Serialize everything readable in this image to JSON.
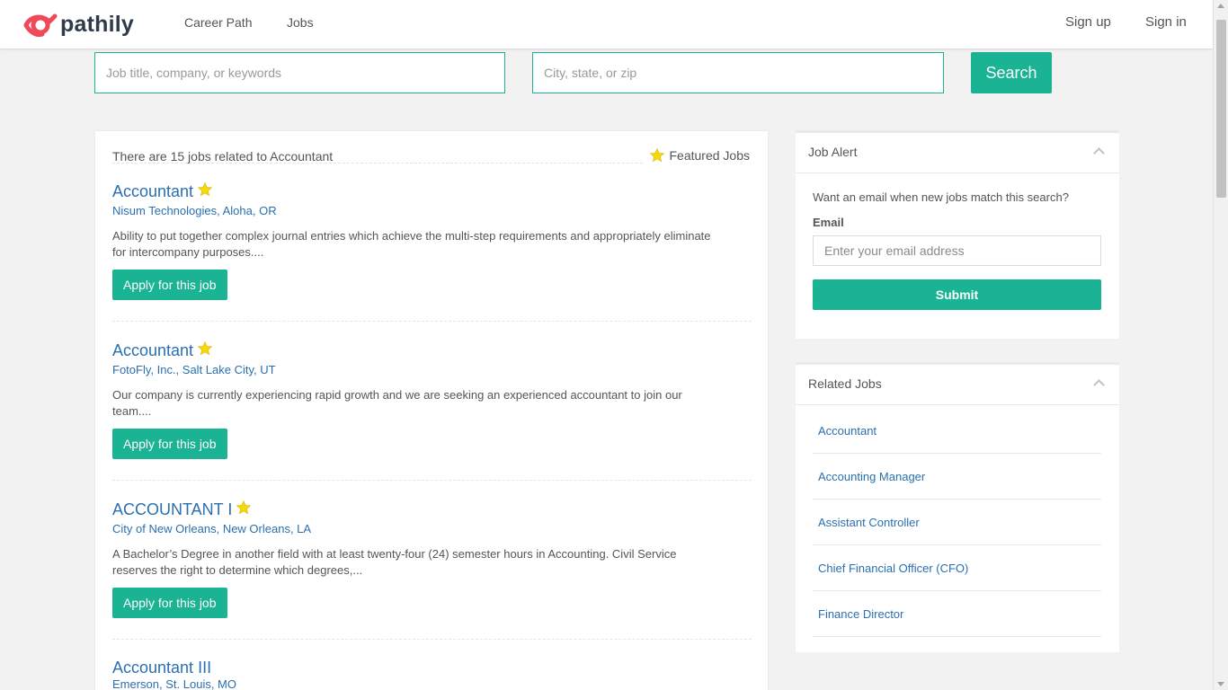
{
  "header": {
    "brand": "pathily",
    "nav": [
      "Career Path",
      "Jobs"
    ],
    "sign_up": "Sign up",
    "sign_in": "Sign in"
  },
  "search": {
    "keywords_placeholder": "Job title, company, or keywords",
    "location_placeholder": "City, state, or zip",
    "button": "Search"
  },
  "results": {
    "summary": "There are 15 jobs related to Accountant",
    "featured_label": "Featured Jobs",
    "jobs": [
      {
        "title": "Accountant",
        "featured": true,
        "company": "Nisum Technologies, Aloha, OR",
        "description": "Ability to put together complex journal entries which achieve the multi-step requirements and appropriately eliminate for intercompany purposes....",
        "apply": "Apply for this job"
      },
      {
        "title": "Accountant",
        "featured": true,
        "company": "FotoFly, Inc., Salt Lake City, UT",
        "description": "Our company is currently experiencing rapid growth and we are seeking an experienced accountant to join our team....",
        "apply": "Apply for this job"
      },
      {
        "title": "ACCOUNTANT I",
        "featured": true,
        "company": "City of New Orleans, New Orleans, LA",
        "description": "A Bachelor’s Degree in another field with at least twenty-four (24) semester hours in Accounting. Civil Service reserves the right to determine which degrees,...",
        "apply": "Apply for this job"
      },
      {
        "title": "Accountant III",
        "featured": false,
        "company": "Emerson, St. Louis, MO"
      }
    ]
  },
  "job_alert": {
    "title": "Job Alert",
    "question": "Want an email when new jobs match this search?",
    "email_label": "Email",
    "email_placeholder": "Enter your email address",
    "submit": "Submit"
  },
  "related_jobs": {
    "title": "Related Jobs",
    "items": [
      "Accountant",
      "Accounting Manager",
      "Assistant Controller",
      "Chief Financial Officer (CFO)",
      "Finance Director"
    ]
  },
  "colors": {
    "accent": "#1ab394",
    "link": "#2a6fb0",
    "star": "#f5d90a",
    "logo_red": "#ef4a5a",
    "logo_dark": "#2f3b4a"
  }
}
